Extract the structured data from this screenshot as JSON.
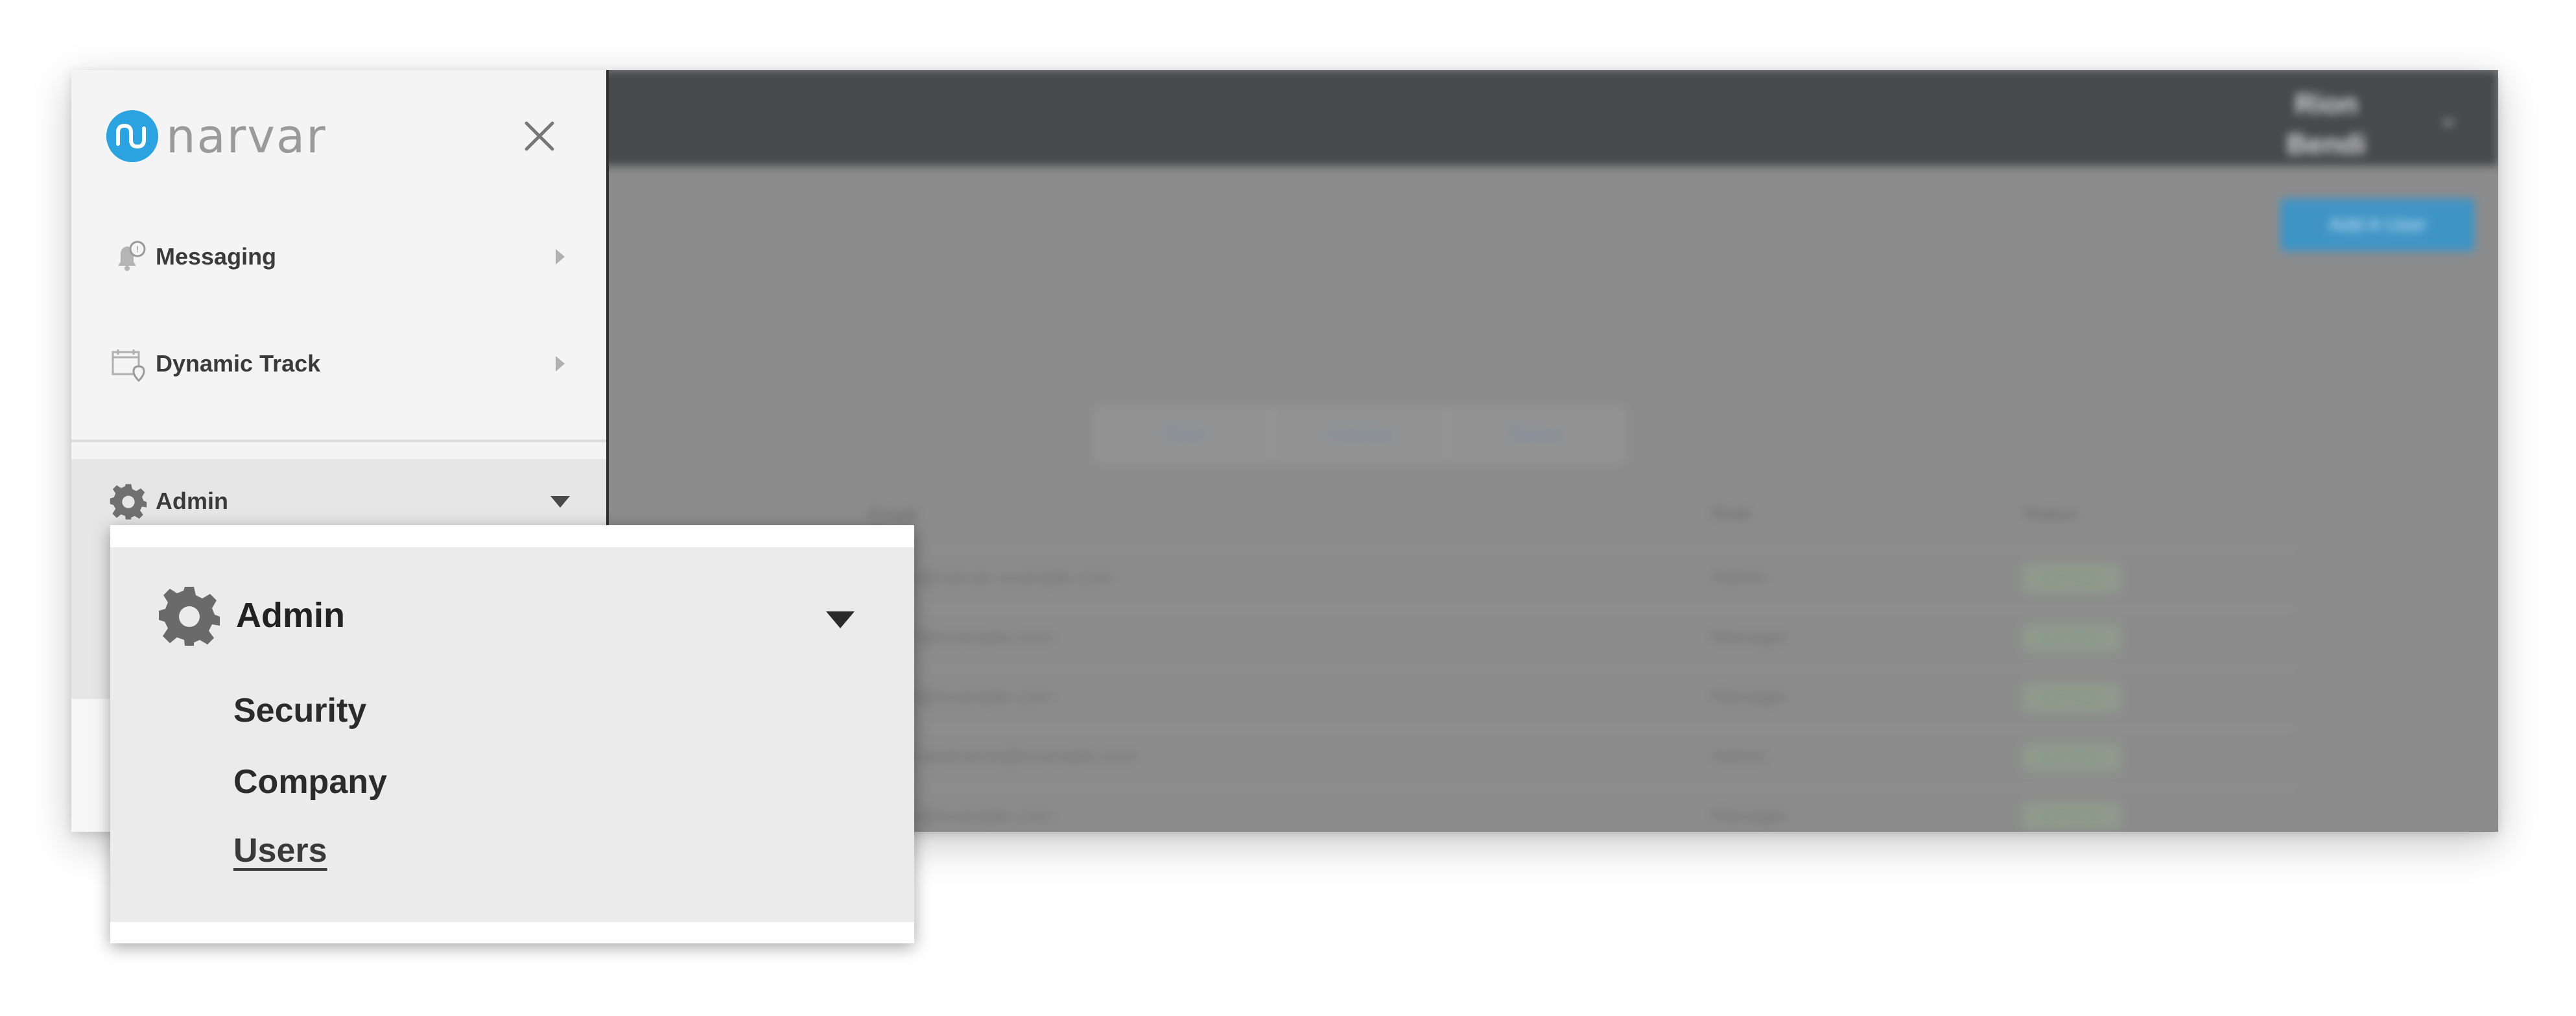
{
  "background": {
    "user_name_line1": "Rion",
    "user_name_line2": "Bendi",
    "add_user_button": "Add A User",
    "filters": [
      "Role",
      "Access",
      "Status"
    ],
    "table": {
      "headers": [
        "Email",
        "Role",
        "Status"
      ],
      "rows": [
        {
          "email": "user1@narvar-example.com",
          "role": "Admin",
          "status": "ACTIVE"
        },
        {
          "email": "user2@example.com",
          "role": "Manager",
          "status": "ACTIVE"
        },
        {
          "email": "user3@example.com",
          "role": "Manager",
          "status": "ACTIVE"
        },
        {
          "email": "user4.lastname@example.com",
          "role": "Admin",
          "status": "ACTIVE"
        },
        {
          "email": "user5@example.com",
          "role": "Manager",
          "status": "ACTIVE"
        }
      ]
    }
  },
  "sidebar": {
    "logo_text": "narvar",
    "items": [
      {
        "label": "Messaging",
        "icon": "bell-icon"
      },
      {
        "label": "Dynamic Track",
        "icon": "calendar-pin-icon"
      }
    ],
    "admin": {
      "label": "Admin",
      "icon": "gear-icon"
    }
  },
  "callout": {
    "title": "Admin",
    "links": [
      {
        "label": "Security",
        "active": false
      },
      {
        "label": "Company",
        "active": false
      },
      {
        "label": "Users",
        "active": true
      }
    ]
  },
  "colors": {
    "brand_blue": "#2aa3e0",
    "header_dark": "#48494b",
    "sidebar_bg": "#f4f4f4",
    "admin_bg": "#e6e6e6"
  }
}
